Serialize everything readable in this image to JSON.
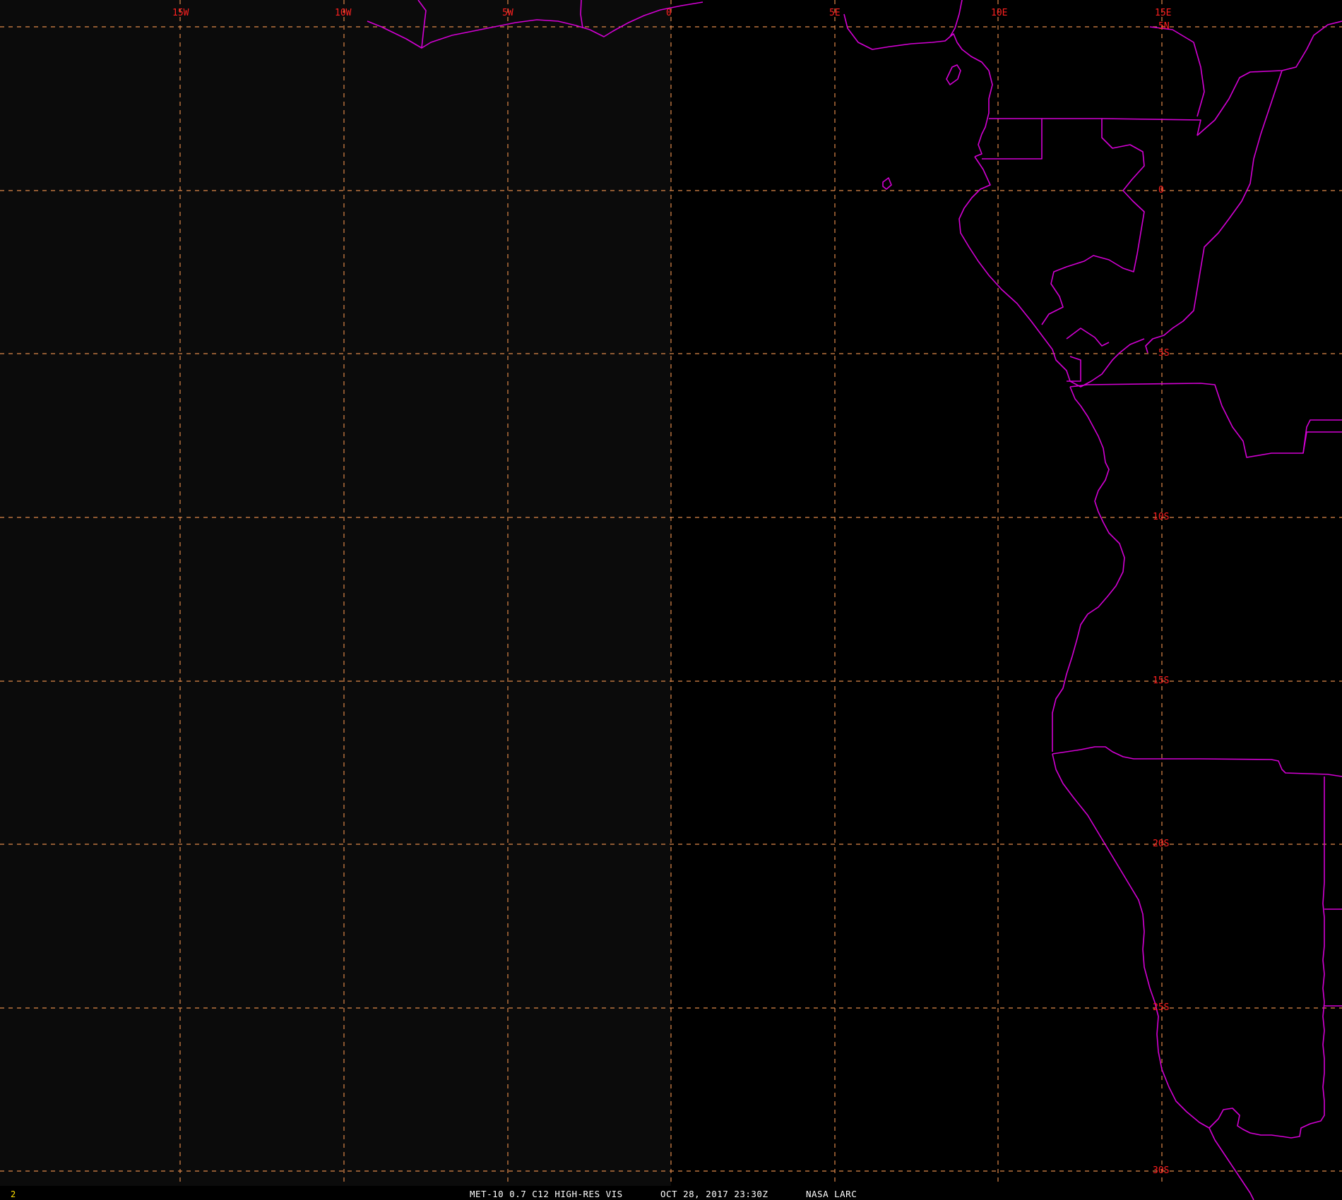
{
  "map": {
    "colors": {
      "background": "#000000",
      "grid": "#e0894a",
      "coastline": "#d400d4",
      "labels": "#ff2020",
      "status_text": "#ffffff",
      "frame_number": "#ffe000"
    },
    "longitude_labels": [
      "15W",
      "10W",
      "5W",
      "0",
      "5E",
      "10E",
      "15E"
    ],
    "latitude_labels": [
      "5N",
      "0",
      "5S",
      "10S",
      "15S",
      "20S",
      "25S",
      "30S"
    ],
    "frame_number": "2",
    "status_bar": {
      "product": "MET-10 0.7 C12 HIGH-RES VIS",
      "datetime": "OCT 28, 2017 23:30Z",
      "source": "NASA LARC"
    }
  }
}
